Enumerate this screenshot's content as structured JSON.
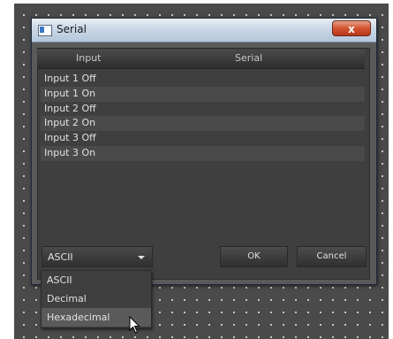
{
  "window": {
    "title": "Serial",
    "close_label": "x"
  },
  "list": {
    "columns": [
      "Input",
      "Serial"
    ],
    "rows": [
      "Input 1 Off",
      "Input 1 On",
      "Input 2 Off",
      "Input 2 On",
      "Input 3 Off",
      "Input 3 On"
    ]
  },
  "format_select": {
    "selected": "ASCII",
    "options": [
      "ASCII",
      "Decimal",
      "Hexadecimal"
    ],
    "hovered": "Hexadecimal"
  },
  "buttons": {
    "ok": "OK",
    "cancel": "Cancel"
  },
  "colors": {
    "close_button": "#d2532f",
    "background": "#4a4a4a"
  },
  "icons": {
    "app": "window-app-icon",
    "dropdown": "chevron-down-icon",
    "cursor": "mouse-pointer-icon"
  }
}
